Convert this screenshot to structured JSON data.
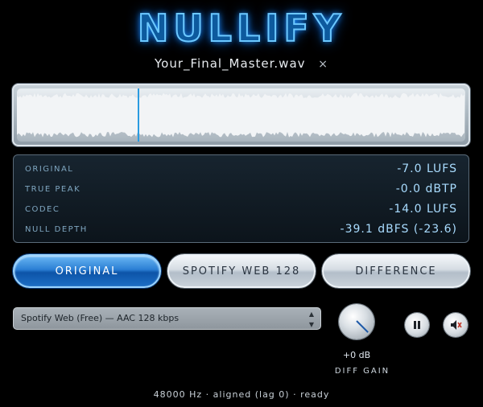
{
  "app": {
    "title": "NULLIFY"
  },
  "file": {
    "name": "Your_Final_Master.wav",
    "close_glyph": "×"
  },
  "waveform": {
    "playhead_position_fraction": 0.27,
    "fill_color": "#f2f4f6",
    "playhead_color": "#2a9be0"
  },
  "meters": [
    {
      "label": "Original",
      "value": "-7.0 LUFS"
    },
    {
      "label": "True Peak",
      "value": "-0.0 dBTP"
    },
    {
      "label": "Codec",
      "value": "-14.0 LUFS"
    },
    {
      "label": "Null Depth",
      "value": "-39.1 dBFS (-23.6)"
    }
  ],
  "modes": {
    "original": "ORIGINAL",
    "spotify": "SPOTIFY WEB 128",
    "difference": "DIFFERENCE",
    "active": "original"
  },
  "codec_select": {
    "value": "Spotify Web (Free) — AAC 128 kbps"
  },
  "gain": {
    "value": "+0 dB",
    "label": "Diff Gain"
  },
  "controls": {
    "pause_icon": "pause-icon",
    "mute_icon": "mute-icon"
  },
  "status": "48000 Hz · aligned (lag 0) · ready",
  "colors": {
    "accent": "#2b7fd4",
    "meter_text": "#a9dcff",
    "label_text": "#7fa6c0"
  }
}
